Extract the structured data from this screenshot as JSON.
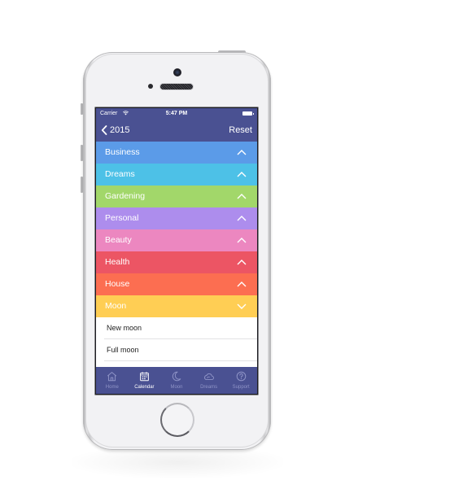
{
  "status_bar": {
    "carrier": "Carrier",
    "wifi_icon": "wifi-icon",
    "time": "5:47 PM",
    "battery_icon": "battery-icon"
  },
  "nav_bar": {
    "back_icon": "chevron-left-icon",
    "back_label": "2015",
    "reset_label": "Reset"
  },
  "categories": [
    {
      "label": "Business",
      "color": "#5b9be8",
      "state": "collapsed",
      "chevron": "chevron-up-icon"
    },
    {
      "label": "Dreams",
      "color": "#4dc1e7",
      "state": "collapsed",
      "chevron": "chevron-up-icon"
    },
    {
      "label": "Gardening",
      "color": "#a2d76a",
      "state": "collapsed",
      "chevron": "chevron-up-icon"
    },
    {
      "label": "Personal",
      "color": "#ad8ded",
      "state": "collapsed",
      "chevron": "chevron-up-icon"
    },
    {
      "label": "Beauty",
      "color": "#ec87c0",
      "state": "collapsed",
      "chevron": "chevron-up-icon"
    },
    {
      "label": "Health",
      "color": "#ec5564",
      "state": "collapsed",
      "chevron": "chevron-up-icon"
    },
    {
      "label": "House",
      "color": "#fc6e51",
      "state": "collapsed",
      "chevron": "chevron-up-icon"
    },
    {
      "label": "Moon",
      "color": "#ffce54",
      "state": "expanded",
      "chevron": "chevron-down-icon",
      "items": [
        {
          "label": "New moon"
        },
        {
          "label": "Full moon"
        }
      ]
    }
  ],
  "tab_bar": {
    "tabs": [
      {
        "label": "Home",
        "icon": "home-icon",
        "active": false
      },
      {
        "label": "Calendar",
        "icon": "calendar-icon",
        "active": true
      },
      {
        "label": "Moon",
        "icon": "moon-icon",
        "active": false
      },
      {
        "label": "Dreams",
        "icon": "cloud-icon",
        "active": false
      },
      {
        "label": "Support",
        "icon": "question-circle-icon",
        "active": false
      }
    ]
  },
  "colors": {
    "primary": "#4a5192",
    "tab_inactive": "#8f94c7",
    "tab_active": "#ffffff"
  }
}
